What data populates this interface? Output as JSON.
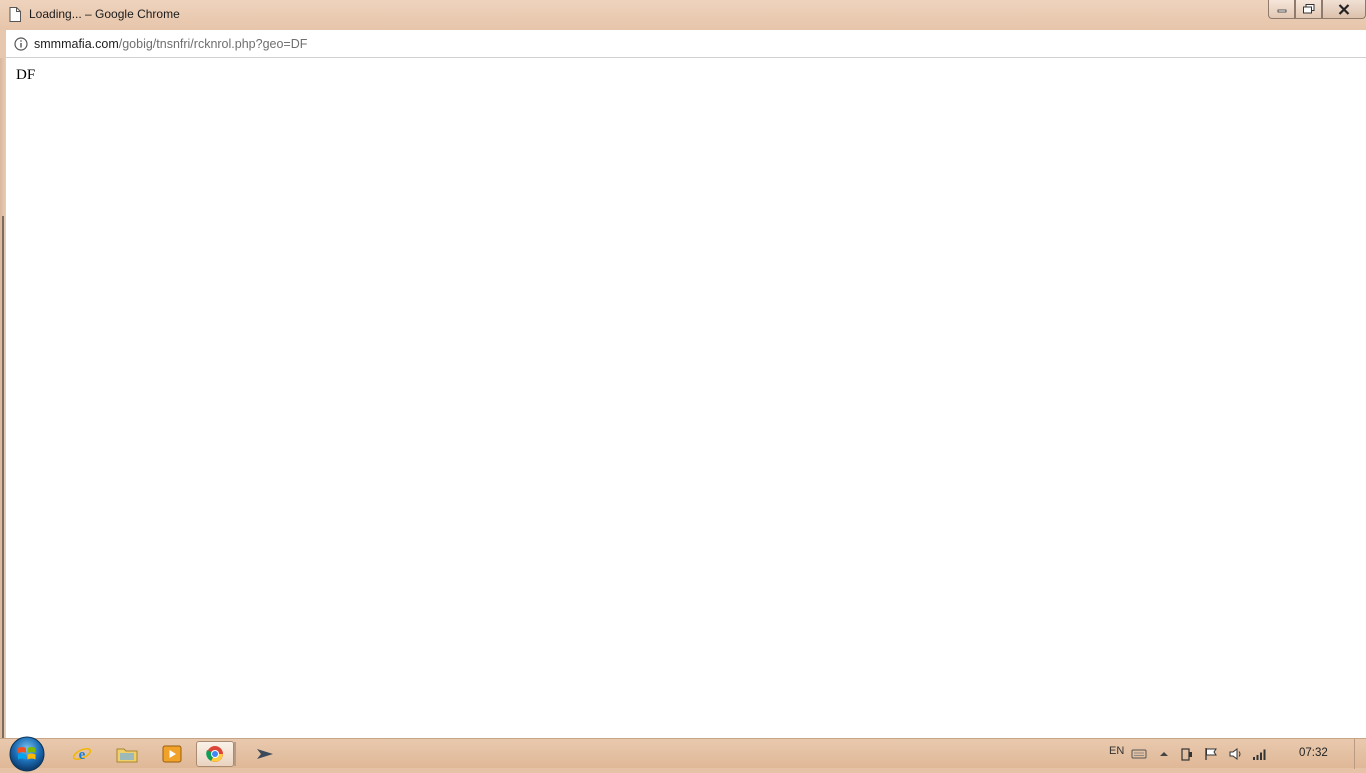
{
  "window": {
    "title": "Loading... – Google Chrome",
    "icons": {
      "page": "document-icon",
      "minimize": "minimize-icon",
      "maximize": "maximize-icon",
      "close": "close-icon"
    }
  },
  "addressbar": {
    "host": "smmmafia.com",
    "path": "/gobig/tnsnfri/rcknrol.php?geo=DF",
    "icon": "info-icon"
  },
  "page": {
    "text": "DF"
  },
  "taskbar": {
    "apps": [
      {
        "name": "internet-explorer",
        "icon": "ie-icon"
      },
      {
        "name": "windows-explorer",
        "icon": "folder-icon"
      },
      {
        "name": "media-player",
        "icon": "media-player-icon"
      },
      {
        "name": "google-chrome",
        "icon": "chrome-icon",
        "active": true
      },
      {
        "name": "app",
        "icon": "arrow-app-icon"
      }
    ],
    "tray": {
      "language": "EN",
      "time": "07:32"
    }
  },
  "colors": {
    "frame": "#e7c7ad",
    "taskbar": "#e2bd9e",
    "content": "#ffffff"
  }
}
